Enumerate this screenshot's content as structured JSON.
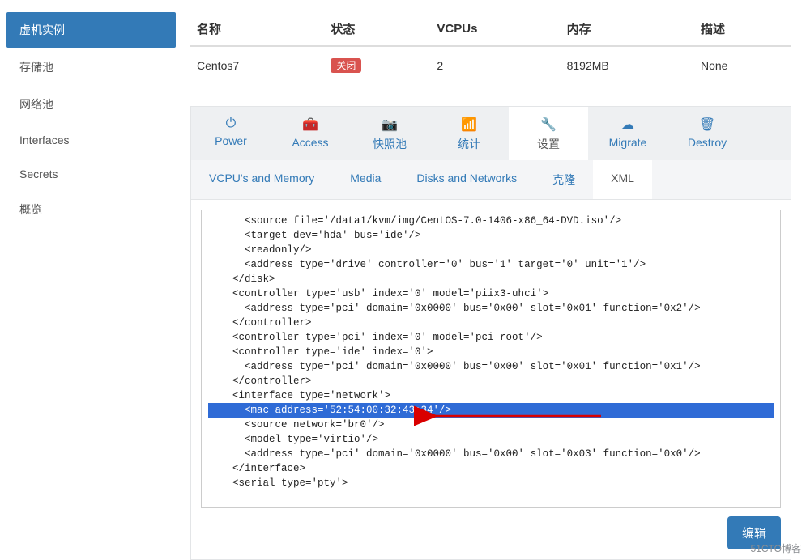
{
  "sidebar": {
    "items": [
      {
        "label": "虚机实例",
        "active": true
      },
      {
        "label": "存储池",
        "active": false
      },
      {
        "label": "网络池",
        "active": false
      },
      {
        "label": "Interfaces",
        "active": false
      },
      {
        "label": "Secrets",
        "active": false
      },
      {
        "label": "概览",
        "active": false
      }
    ]
  },
  "table": {
    "headers": {
      "name": "名称",
      "state": "状态",
      "vcpus": "VCPUs",
      "memory": "内存",
      "desc": "描述"
    },
    "row": {
      "name": "Centos7",
      "state": "关闭",
      "vcpus": "2",
      "memory": "8192MB",
      "desc": "None"
    }
  },
  "actions": [
    {
      "icon": "⏻",
      "label": "Power"
    },
    {
      "icon": "🧰",
      "label": "Access"
    },
    {
      "icon": "📷",
      "label": "快照池"
    },
    {
      "icon": "📶",
      "label": "统计"
    },
    {
      "icon": "🔧",
      "label": "设置",
      "active": true
    },
    {
      "icon": "☁",
      "label": "Migrate"
    },
    {
      "icon": "🗑",
      "label": "Destroy"
    }
  ],
  "subtabs": [
    {
      "label": "VCPU's and Memory"
    },
    {
      "label": "Media"
    },
    {
      "label": "Disks and Networks"
    },
    {
      "label": "克隆"
    },
    {
      "label": "XML",
      "active": true
    }
  ],
  "xml": {
    "lines": [
      "      <source file='/data1/kvm/img/CentOS-7.0-1406-x86_64-DVD.iso'/>",
      "      <target dev='hda' bus='ide'/>",
      "      <readonly/>",
      "      <address type='drive' controller='0' bus='1' target='0' unit='1'/>",
      "    </disk>",
      "    <controller type='usb' index='0' model='piix3-uhci'>",
      "      <address type='pci' domain='0x0000' bus='0x00' slot='0x01' function='0x2'/>",
      "    </controller>",
      "    <controller type='pci' index='0' model='pci-root'/>",
      "    <controller type='ide' index='0'>",
      "      <address type='pci' domain='0x0000' bus='0x00' slot='0x01' function='0x1'/>",
      "    </controller>",
      "    <interface type='network'>",
      "      <mac address='52:54:00:32:43:34'/>",
      "      <source network='br0'/>",
      "      <model type='virtio'/>",
      "      <address type='pci' domain='0x0000' bus='0x00' slot='0x03' function='0x0'/>",
      "    </interface>",
      "    <serial type='pty'>"
    ],
    "highlight_index": 13
  },
  "edit_button": "编辑",
  "watermark": "51CTO博客"
}
